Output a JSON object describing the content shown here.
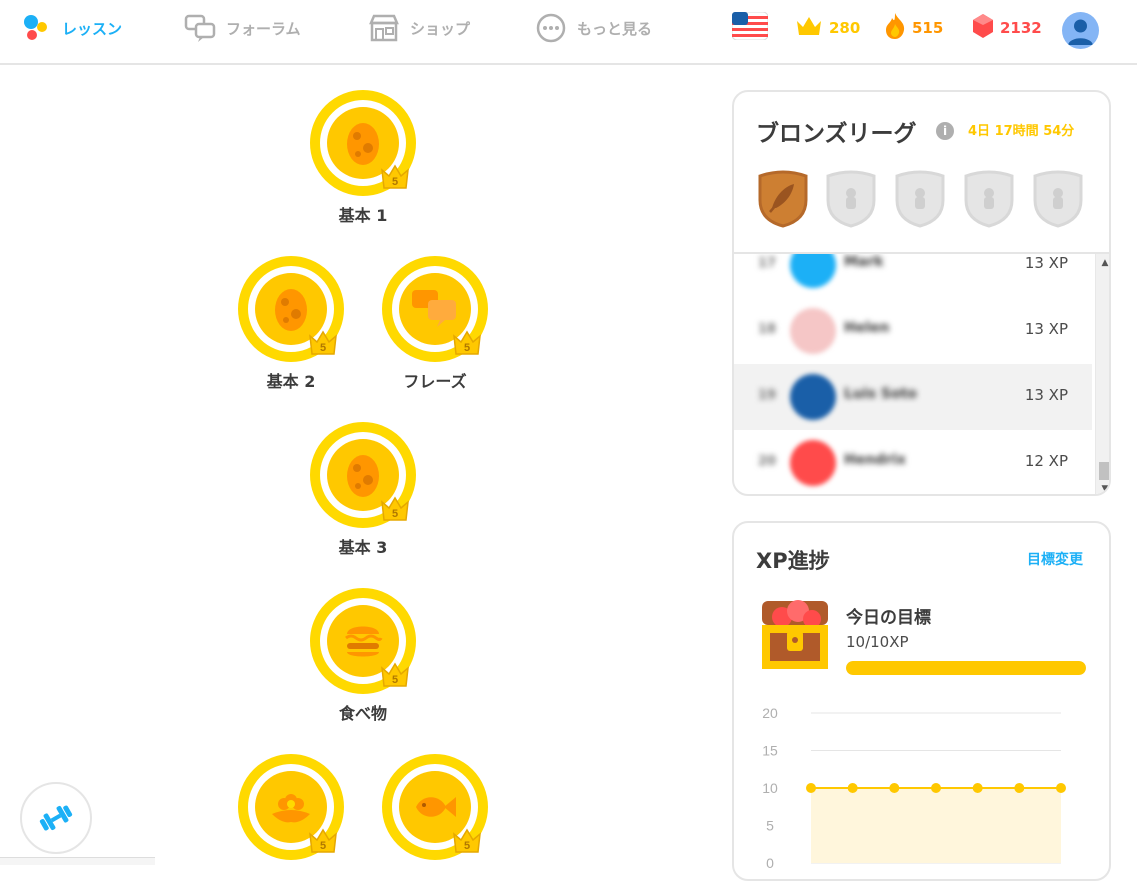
{
  "colors": {
    "accent": "#1cb0f6",
    "gold": "#ffc800",
    "streak": "#ff9600",
    "gem": "#ff4b4b",
    "muted": "#afafaf"
  },
  "nav": {
    "items": [
      {
        "label": "レッスン",
        "icon": "lessons-dots-icon",
        "active": true
      },
      {
        "label": "フォーラム",
        "icon": "forum-speech-bubbles-icon",
        "active": false
      },
      {
        "label": "ショップ",
        "icon": "shop-storefront-icon",
        "active": false
      },
      {
        "label": "もっと見る",
        "icon": "more-dots-icon",
        "active": false
      }
    ],
    "language_flag": "us-flag-icon",
    "crowns": "280",
    "streak": "515",
    "gems": "2132",
    "avatar": "user-avatar-icon"
  },
  "skills": [
    {
      "label": "基本 1",
      "icon": "egg-icon",
      "level": "5"
    },
    {
      "label": "基本 2",
      "icon": "egg-icon",
      "level": "5"
    },
    {
      "label": "フレーズ",
      "icon": "speech-bubbles-icon",
      "level": "5"
    },
    {
      "label": "基本 3",
      "icon": "egg-icon",
      "level": "5"
    },
    {
      "label": "食べ物",
      "icon": "burger-icon",
      "level": "5"
    },
    {
      "label": "",
      "icon": "flower-icon",
      "level": "5"
    },
    {
      "label": "",
      "icon": "fish-icon",
      "level": "5"
    }
  ],
  "league": {
    "title": "ブロンズリーグ",
    "time_left": "4日 17時間 54分",
    "badges": [
      "bronze-feather-badge-icon",
      "locked-league-badge-icon",
      "locked-league-badge-icon",
      "locked-league-badge-icon",
      "locked-league-badge-icon"
    ],
    "rows": [
      {
        "rank": "17",
        "name": "Mark",
        "xp": "13 XP",
        "avatar_color": "#1cb0f6",
        "highlight": false
      },
      {
        "rank": "18",
        "name": "Helen",
        "xp": "13 XP",
        "avatar_color": "#f5c6c6",
        "highlight": false
      },
      {
        "rank": "19",
        "name": "Luis Soto",
        "xp": "13 XP",
        "avatar_color": "#1a5fa8",
        "highlight": true
      },
      {
        "rank": "20",
        "name": "Hendrix",
        "xp": "12 XP",
        "avatar_color": "#ff4b4b",
        "highlight": false
      }
    ]
  },
  "xp": {
    "title": "XP進捗",
    "change_goal": "目標変更",
    "goal_label": "今日の目標",
    "goal_value": "10/10XP",
    "goal_progress": 1.0
  },
  "chart_data": {
    "type": "line",
    "title": "",
    "xlabel": "",
    "ylabel": "",
    "ylim": [
      0,
      20
    ],
    "yticks": [
      "20",
      "15",
      "10",
      "5",
      "0"
    ],
    "x": [
      1,
      2,
      3,
      4,
      5,
      6,
      7
    ],
    "series": [
      {
        "values": [
          10,
          10,
          10,
          10,
          10,
          10,
          10
        ]
      }
    ],
    "fill": "area",
    "grid": true
  }
}
